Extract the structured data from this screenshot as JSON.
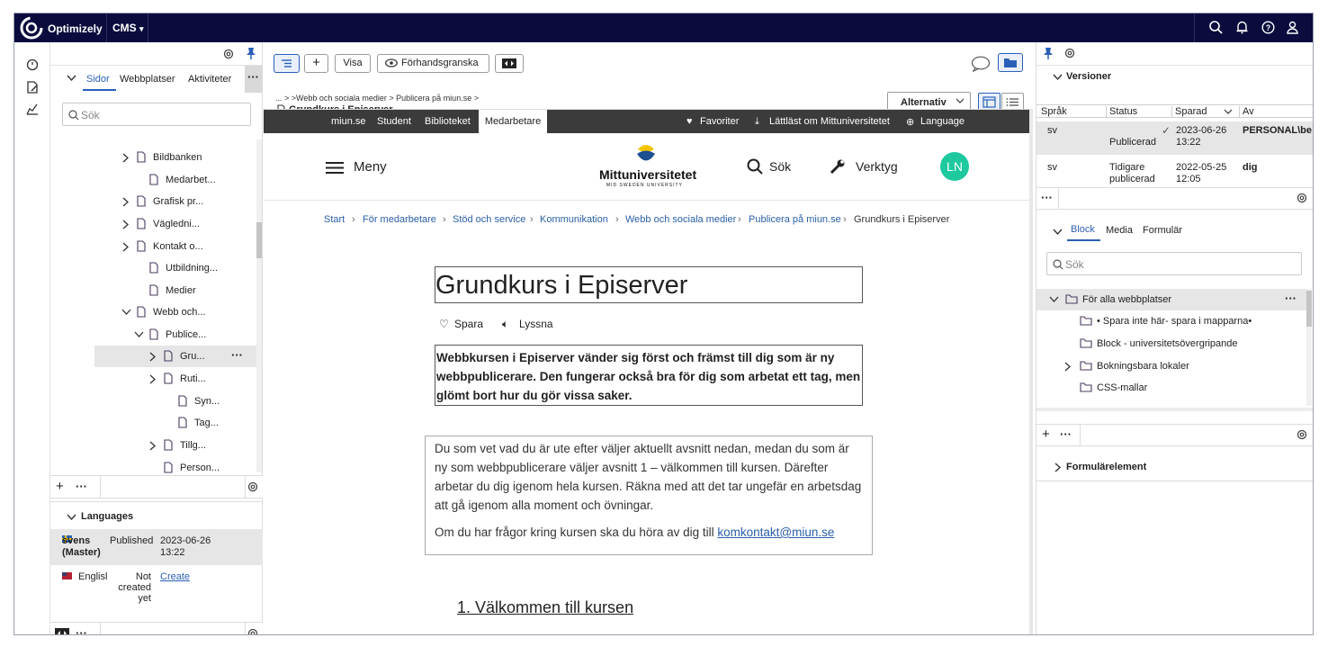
{
  "topbar": {
    "brand": "Optimizely",
    "product": "CMS",
    "icons": [
      "search-icon",
      "bell-icon",
      "help-icon",
      "user-icon"
    ]
  },
  "left": {
    "tabs": [
      "Sidor",
      "Webbplatser",
      "Aktiviteter"
    ],
    "search_placeholder": "Sök",
    "tree": [
      {
        "label": "Bildbanken",
        "chevron": "right"
      },
      {
        "label": "Medarbet...",
        "chevron": ""
      },
      {
        "label": "Grafisk pr...",
        "chevron": "right"
      },
      {
        "label": "Vägledni...",
        "chevron": "right"
      },
      {
        "label": "Kontakt o...",
        "chevron": "right"
      },
      {
        "label": "Utbildning...",
        "chevron": ""
      },
      {
        "label": "Medier",
        "chevron": ""
      },
      {
        "label": "Webb och...",
        "chevron": "down"
      },
      {
        "label": "Publice...",
        "chevron": "down"
      },
      {
        "label": "Gru...",
        "chevron": "right",
        "selected": true
      },
      {
        "label": "Ruti...",
        "chevron": "right"
      },
      {
        "label": "Syn...",
        "chevron": ""
      },
      {
        "label": "Tag...",
        "chevron": ""
      },
      {
        "label": "Tillg...",
        "chevron": "right"
      },
      {
        "label": "Person...",
        "chevron": ""
      }
    ],
    "languages": {
      "header": "Languages",
      "rows": [
        {
          "lang": "svens\n(Master)",
          "status": "Published",
          "date": "2023-06-26\n13:22"
        },
        {
          "lang": "Englisl",
          "status": "Not\ncreated\nyet",
          "action": "Create"
        }
      ]
    }
  },
  "toolbar": {
    "visa": "Visa",
    "preview": "Förhandsgranska",
    "breadcrumb_top": "... > >Webb och sociala medier > Publicera på miun.se >",
    "page_title": "Grundkurs i Episerver",
    "alternativ": "Alternativ"
  },
  "preview": {
    "topnav": [
      "miun.se",
      "Student",
      "Biblioteket",
      "Medarbetare"
    ],
    "topnav_right": [
      "Favoriter",
      "Lättläst om Mittuniversitetet",
      "Language"
    ],
    "meny": "Meny",
    "university": "Mittuniversitetet",
    "university_sub": "MID SWEDEN UNIVERSITY",
    "sok": "Sök",
    "verktyg": "Verktyg",
    "avatar": "LN",
    "crumbs": [
      "Start",
      "För medarbetare",
      "Stöd och service",
      "Kommunikation",
      "Webb och sociala medier",
      "Publicera på miun.se",
      "Grundkurs i Episerver"
    ],
    "heading": "Grundkurs i Episerver",
    "spara": "Spara",
    "lyssna": "Lyssna",
    "intro": "Webbkursen i Episerver vänder sig först och främst till dig som är ny webbpublicerare. Den fungerar också bra för dig som arbetat ett tag, men glömt bort hur du gör vissa saker.",
    "body1": "Du som vet vad du är ute efter väljer aktuellt avsnitt nedan, medan du som är ny som webbpublicerare väljer avsnitt 1 – välkommen till kursen. Därefter arbetar du dig igenom hela kursen. Räkna med att det tar ungefär en arbetsdag att gå igenom alla moment och övningar.",
    "body2_prefix": "Om du har frågor kring kursen ska du höra av dig till ",
    "email": "komkontakt@miun.se",
    "section1": "1. Välkommen till kursen"
  },
  "right": {
    "versions_title": "Versioner",
    "columns": [
      "Språk",
      "Status",
      "Sparad",
      "Av"
    ],
    "versions": [
      {
        "lang": "sv",
        "status": "Publicerad",
        "saved": "2023-06-26\n13:22",
        "by": "PERSONAL\\be"
      },
      {
        "lang": "sv",
        "status": "Tidigare\npublicerad",
        "saved": "2022-05-25\n12:05",
        "by": "dig"
      }
    ],
    "block_tabs": [
      "Block",
      "Media",
      "Formulär"
    ],
    "search_placeholder": "Sök",
    "folders": [
      {
        "label": "För alla webbplatser",
        "chevron": "down"
      },
      {
        "label": "• Spara inte här- spara i mapparna•",
        "chevron": ""
      },
      {
        "label": "Block - universitetsövergripande",
        "chevron": ""
      },
      {
        "label": "Bokningsbara lokaler",
        "chevron": "right"
      },
      {
        "label": "CSS-mallar",
        "chevron": ""
      }
    ],
    "formularelement": "Formulärelement"
  },
  "colors": {
    "topbar": "#0b0c3d",
    "accent": "#2a5fb8",
    "miunbar": "#3b3b3b",
    "avatar": "#1ec9a0"
  }
}
